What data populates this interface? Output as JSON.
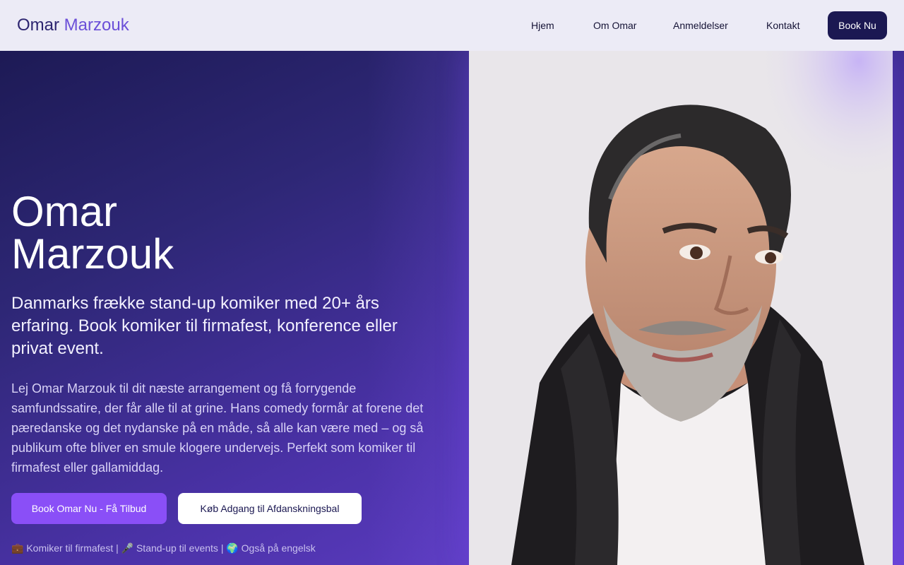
{
  "header": {
    "brand_first": "Omar",
    "brand_second": "Marzouk",
    "nav": [
      "Hjem",
      "Om Omar",
      "Anmeldelser",
      "Kontakt"
    ],
    "book_label": "Book Nu"
  },
  "hero": {
    "title_line1": "Omar",
    "title_line2": "Marzouk",
    "subtitle": "Danmarks frække stand-up komiker med 20+ års erfaring. Book komiker til firmafest, konference eller privat event.",
    "body": "Lej Omar Marzouk til dit næste arrangement og få forrygende samfundssatire, der får alle til at grine. Hans comedy formår at forene det pæredanske og det nydanske på en måde, så alle kan være med – og så publikum ofte bliver en smule klogere undervejs. Perfekt som komiker til firmafest eller gallamiddag.",
    "cta_primary": "Book Omar Nu - Få Tilbud",
    "cta_secondary": "Køb Adgang til Afdanskningsbal",
    "tagline": "💼 Komiker til firmafest | 🎤 Stand-up til events | 🌍 Også på engelsk"
  },
  "colors": {
    "nav_bg": "#ecebf6",
    "brand_dark": "#2d2570",
    "brand_accent": "#6b4fd8",
    "hero_start": "#1d1a55",
    "hero_end": "#6a44d6",
    "cta_primary": "#8a4ff7",
    "book_button": "#1b1852"
  }
}
